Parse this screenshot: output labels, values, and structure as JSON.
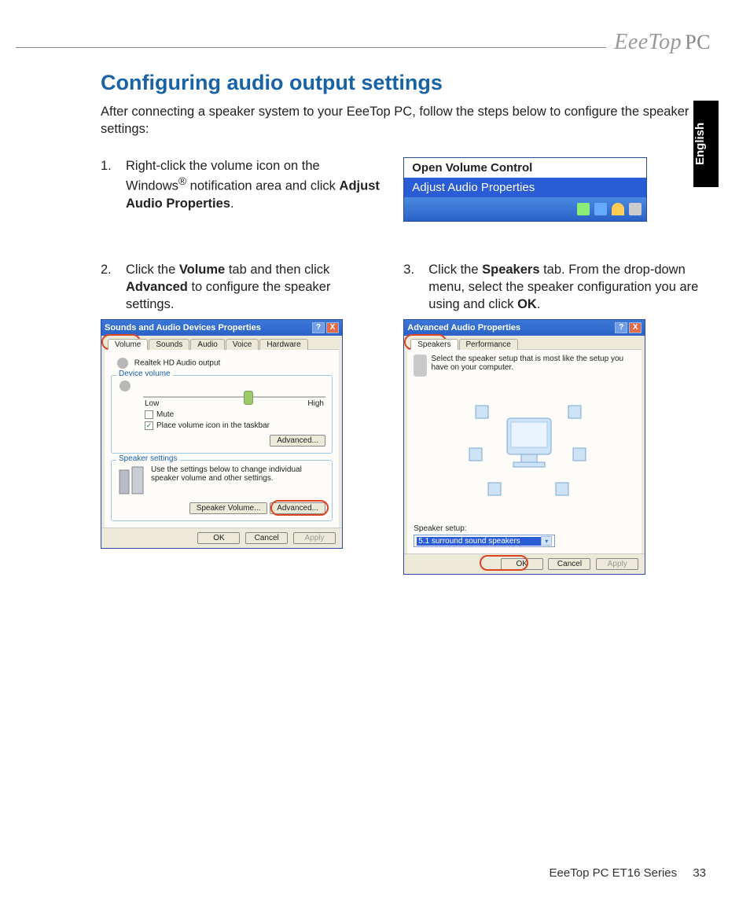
{
  "logo": "EeeTop PC",
  "language_tab": "English",
  "title": "Configuring audio output settings",
  "intro": "After connecting a speaker system to your EeeTop PC, follow the steps below to configure the speaker settings:",
  "steps": {
    "s1": {
      "num": "1.",
      "pre": "Right-click the volume icon on the Windows",
      "sup": "®",
      "mid": " notification area and click ",
      "bold": "Adjust Audio Properties",
      "post": "."
    },
    "s2": {
      "num": "2.",
      "pre": "Click the ",
      "b1": "Volume",
      "mid1": " tab and then click ",
      "b2": "Advanced",
      "post": " to configure the speaker settings."
    },
    "s3": {
      "num": "3.",
      "pre": "Click the ",
      "b1": "Speakers",
      "mid1": " tab. From the drop-down menu, select the speaker configuration you are using and click ",
      "b2": "OK",
      "post": "."
    }
  },
  "ctx": {
    "open": "Open Volume Control",
    "adjust": "Adjust Audio Properties"
  },
  "dlg1": {
    "title": "Sounds and Audio Devices Properties",
    "tabs": {
      "volume": "Volume",
      "sounds": "Sounds",
      "audio": "Audio",
      "voice": "Voice",
      "hardware": "Hardware"
    },
    "device": "Realtek HD Audio output",
    "legend_vol": "Device volume",
    "low": "Low",
    "high": "High",
    "mute": "Mute",
    "place_icon": "Place volume icon in the taskbar",
    "advanced": "Advanced...",
    "legend_spk": "Speaker settings",
    "spk_desc": "Use the settings below to change individual speaker volume and other settings.",
    "spk_vol": "Speaker Volume...",
    "ok": "OK",
    "cancel": "Cancel",
    "apply": "Apply"
  },
  "dlg2": {
    "title": "Advanced Audio Properties",
    "tabs": {
      "speakers": "Speakers",
      "performance": "Performance"
    },
    "desc": "Select the speaker setup that is most like the setup you have on your computer.",
    "label": "Speaker setup:",
    "selected": "5.1 surround sound speakers",
    "ok": "OK",
    "cancel": "Cancel",
    "apply": "Apply"
  },
  "footer": {
    "model": "EeeTop PC ET16 Series",
    "page": "33"
  }
}
